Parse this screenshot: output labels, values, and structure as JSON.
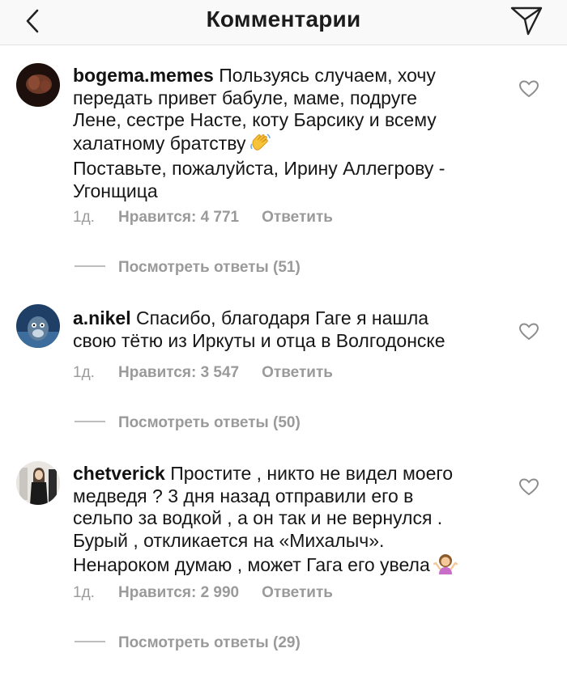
{
  "header": {
    "title": "Комментарии",
    "back_icon": "chevron-left-icon",
    "send_icon": "paper-plane-icon"
  },
  "comments": [
    {
      "username": "bogema.memes",
      "text_lines": [
        "Пользуясь случаем, хочу",
        "передать привет бабуле, маме, подруге",
        "Лене, сестре Насте, коту Барсику и всему",
        "халатному братству",
        "Поставьте, пожалуйста, Ирину Аллегрову -",
        "Угонщица"
      ],
      "emoji": "waving-hand-emoji",
      "time": "1д.",
      "likes": "Нравится: 4 771",
      "reply": "Ответить",
      "view_replies": "Посмотреть ответы (51)"
    },
    {
      "username": "a.nikel",
      "text_lines": [
        "Спасибо, благодаря Гаге я нашла",
        "свою тётю из Иркуты и отца в Волгодонске"
      ],
      "time": "1д.",
      "likes": "Нравится: 3 547",
      "reply": "Ответить",
      "view_replies": "Посмотреть ответы (50)"
    },
    {
      "username": "chetverick",
      "text_lines": [
        "Простите , никто не видел моего",
        "медведя ? 3 дня назад отправили его в",
        "сельпо за водкой , а он так и не вернулся .",
        "Бурый , откликается на «Михалыч».",
        "Ненароком думаю , может Гага его увела"
      ],
      "emoji": "person-shrugging-emoji",
      "time": "1д.",
      "likes": "Нравится: 2 990",
      "reply": "Ответить",
      "view_replies": "Посмотреть ответы (29)"
    }
  ]
}
